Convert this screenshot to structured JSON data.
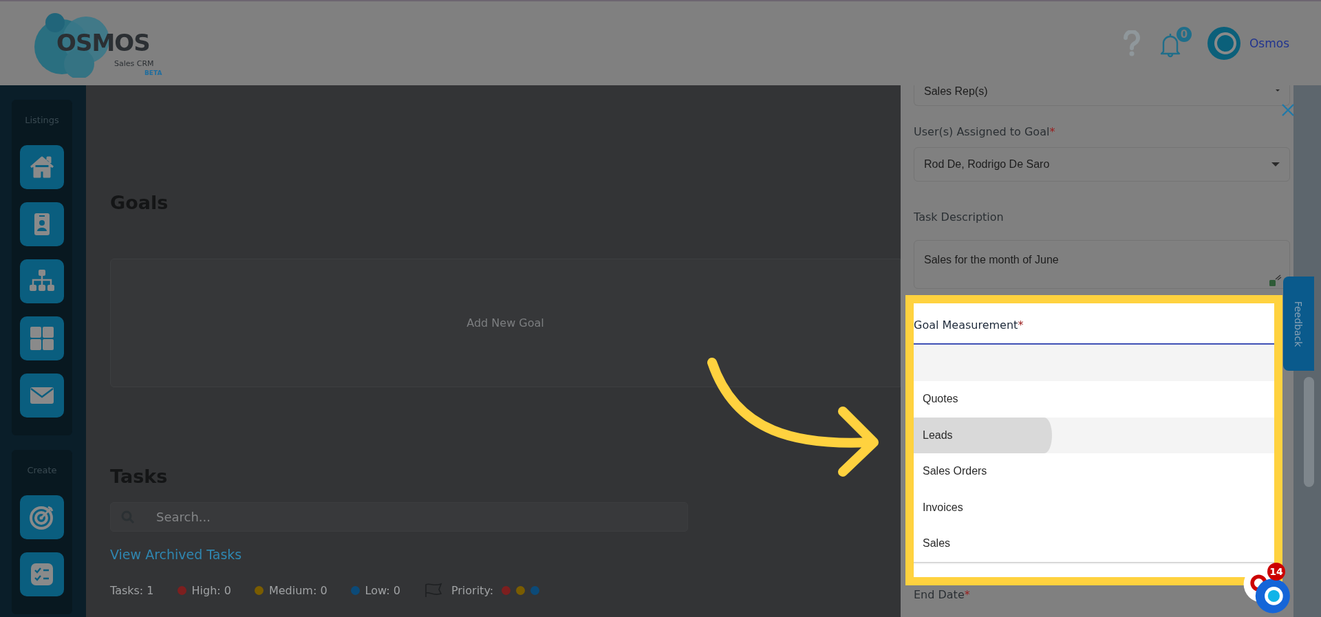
{
  "header": {
    "logo": {
      "name": "OSMOS",
      "subtitle": "Sales CRM",
      "tag": "BETA"
    },
    "notifications": {
      "count": "0"
    },
    "user": {
      "name": "Osmos"
    }
  },
  "sidebar": {
    "sections": [
      {
        "title": "Listings",
        "items": [
          {
            "kind": "home"
          },
          {
            "kind": "contact"
          },
          {
            "kind": "hierarchy"
          },
          {
            "kind": "grid"
          },
          {
            "kind": "mail"
          }
        ]
      },
      {
        "title": "Create",
        "items": [
          {
            "kind": "target"
          },
          {
            "kind": "checklist"
          }
        ]
      }
    ]
  },
  "main": {
    "goals": {
      "title": "Goals",
      "add_label": "Add New Goal"
    },
    "tasks": {
      "title": "Tasks",
      "search": {
        "placeholder": "Search..."
      },
      "archived_link": "View Archived Tasks",
      "stats": [
        {
          "label": "Tasks: 1"
        },
        {
          "label": "High: 0",
          "color": "#7d1f1f"
        },
        {
          "label": "Medium: 0",
          "color": "#7a5c00"
        },
        {
          "label": "Low: 0",
          "color": "#0c4a78"
        }
      ],
      "priority": {
        "label": "Priority:",
        "dots": [
          {
            "color": "#7d1f1f"
          },
          {
            "color": "#7a5c00"
          },
          {
            "color": "#0c4a78"
          }
        ]
      }
    }
  },
  "panel": {
    "top_select": {
      "value": "Sales Rep(s)"
    },
    "fields": [
      {
        "kind": "select",
        "label": "User(s) Assigned to Goal",
        "mark": "*",
        "value": "Rod De, Rodrigo De Saro"
      },
      {
        "kind": "textarea",
        "label": "Task Description",
        "value": "Sales for the month of June"
      }
    ],
    "measurement": {
      "label": "Goal Measurement",
      "mark": "*",
      "options": [
        {
          "label": "Quotes",
          "selected": false
        },
        {
          "label": "Leads",
          "selected": true
        },
        {
          "label": "Sales Orders",
          "selected": false
        },
        {
          "label": "Invoices",
          "selected": false
        },
        {
          "label": "Sales",
          "selected": false
        }
      ]
    },
    "end_date": {
      "label": "End Date",
      "mark": "*"
    }
  },
  "feedback": {
    "label": "Feedback"
  },
  "chat": {
    "badge": "14"
  }
}
